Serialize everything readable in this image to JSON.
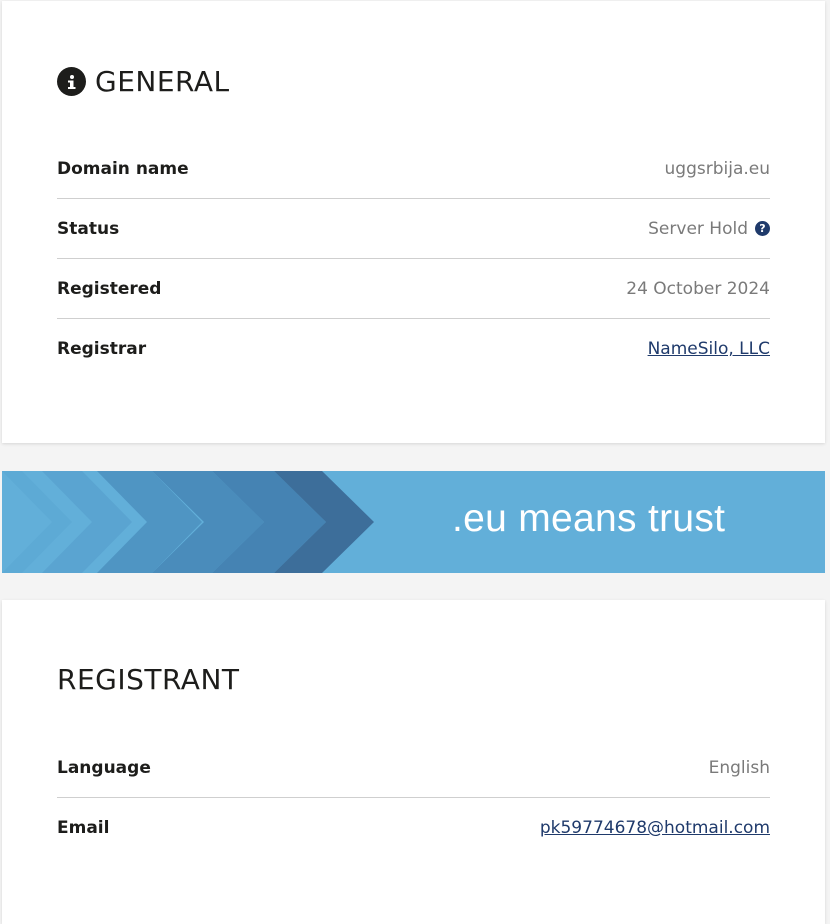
{
  "general": {
    "title": "GENERAL",
    "icon": "info-icon",
    "rows": [
      {
        "label": "Domain name",
        "value": "uggsrbija.eu"
      },
      {
        "label": "Status",
        "value": "Server Hold",
        "icon": "help-icon"
      },
      {
        "label": "Registered",
        "value": "24 October 2024"
      },
      {
        "label": "Registrar",
        "value": "NameSilo, LLC",
        "link": true
      }
    ]
  },
  "banner": {
    "text": ".eu means trust",
    "background": "#62afd9"
  },
  "registrant": {
    "title": "REGISTRANT",
    "rows": [
      {
        "label": "Language",
        "value": "English"
      },
      {
        "label": "Email",
        "value": "pk59774678@hotmail.com",
        "link": true
      }
    ]
  },
  "colors": {
    "link": "#1f3a6b",
    "text": "#1d1d1b",
    "muted": "#7a7a7a"
  }
}
